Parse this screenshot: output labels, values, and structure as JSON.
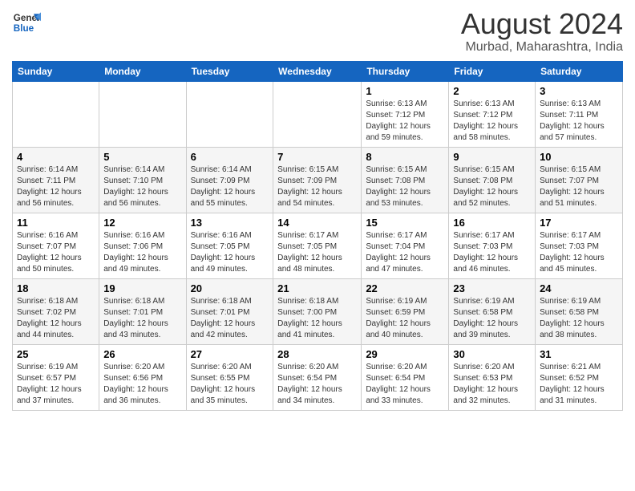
{
  "header": {
    "logo_line1": "General",
    "logo_line2": "Blue",
    "main_title": "August 2024",
    "subtitle": "Murbad, Maharashtra, India"
  },
  "days_of_week": [
    "Sunday",
    "Monday",
    "Tuesday",
    "Wednesday",
    "Thursday",
    "Friday",
    "Saturday"
  ],
  "weeks": [
    [
      {
        "day": "",
        "info": ""
      },
      {
        "day": "",
        "info": ""
      },
      {
        "day": "",
        "info": ""
      },
      {
        "day": "",
        "info": ""
      },
      {
        "day": "1",
        "info": "Sunrise: 6:13 AM\nSunset: 7:12 PM\nDaylight: 12 hours\nand 59 minutes."
      },
      {
        "day": "2",
        "info": "Sunrise: 6:13 AM\nSunset: 7:12 PM\nDaylight: 12 hours\nand 58 minutes."
      },
      {
        "day": "3",
        "info": "Sunrise: 6:13 AM\nSunset: 7:11 PM\nDaylight: 12 hours\nand 57 minutes."
      }
    ],
    [
      {
        "day": "4",
        "info": "Sunrise: 6:14 AM\nSunset: 7:11 PM\nDaylight: 12 hours\nand 56 minutes."
      },
      {
        "day": "5",
        "info": "Sunrise: 6:14 AM\nSunset: 7:10 PM\nDaylight: 12 hours\nand 56 minutes."
      },
      {
        "day": "6",
        "info": "Sunrise: 6:14 AM\nSunset: 7:09 PM\nDaylight: 12 hours\nand 55 minutes."
      },
      {
        "day": "7",
        "info": "Sunrise: 6:15 AM\nSunset: 7:09 PM\nDaylight: 12 hours\nand 54 minutes."
      },
      {
        "day": "8",
        "info": "Sunrise: 6:15 AM\nSunset: 7:08 PM\nDaylight: 12 hours\nand 53 minutes."
      },
      {
        "day": "9",
        "info": "Sunrise: 6:15 AM\nSunset: 7:08 PM\nDaylight: 12 hours\nand 52 minutes."
      },
      {
        "day": "10",
        "info": "Sunrise: 6:15 AM\nSunset: 7:07 PM\nDaylight: 12 hours\nand 51 minutes."
      }
    ],
    [
      {
        "day": "11",
        "info": "Sunrise: 6:16 AM\nSunset: 7:07 PM\nDaylight: 12 hours\nand 50 minutes."
      },
      {
        "day": "12",
        "info": "Sunrise: 6:16 AM\nSunset: 7:06 PM\nDaylight: 12 hours\nand 49 minutes."
      },
      {
        "day": "13",
        "info": "Sunrise: 6:16 AM\nSunset: 7:05 PM\nDaylight: 12 hours\nand 49 minutes."
      },
      {
        "day": "14",
        "info": "Sunrise: 6:17 AM\nSunset: 7:05 PM\nDaylight: 12 hours\nand 48 minutes."
      },
      {
        "day": "15",
        "info": "Sunrise: 6:17 AM\nSunset: 7:04 PM\nDaylight: 12 hours\nand 47 minutes."
      },
      {
        "day": "16",
        "info": "Sunrise: 6:17 AM\nSunset: 7:03 PM\nDaylight: 12 hours\nand 46 minutes."
      },
      {
        "day": "17",
        "info": "Sunrise: 6:17 AM\nSunset: 7:03 PM\nDaylight: 12 hours\nand 45 minutes."
      }
    ],
    [
      {
        "day": "18",
        "info": "Sunrise: 6:18 AM\nSunset: 7:02 PM\nDaylight: 12 hours\nand 44 minutes."
      },
      {
        "day": "19",
        "info": "Sunrise: 6:18 AM\nSunset: 7:01 PM\nDaylight: 12 hours\nand 43 minutes."
      },
      {
        "day": "20",
        "info": "Sunrise: 6:18 AM\nSunset: 7:01 PM\nDaylight: 12 hours\nand 42 minutes."
      },
      {
        "day": "21",
        "info": "Sunrise: 6:18 AM\nSunset: 7:00 PM\nDaylight: 12 hours\nand 41 minutes."
      },
      {
        "day": "22",
        "info": "Sunrise: 6:19 AM\nSunset: 6:59 PM\nDaylight: 12 hours\nand 40 minutes."
      },
      {
        "day": "23",
        "info": "Sunrise: 6:19 AM\nSunset: 6:58 PM\nDaylight: 12 hours\nand 39 minutes."
      },
      {
        "day": "24",
        "info": "Sunrise: 6:19 AM\nSunset: 6:58 PM\nDaylight: 12 hours\nand 38 minutes."
      }
    ],
    [
      {
        "day": "25",
        "info": "Sunrise: 6:19 AM\nSunset: 6:57 PM\nDaylight: 12 hours\nand 37 minutes."
      },
      {
        "day": "26",
        "info": "Sunrise: 6:20 AM\nSunset: 6:56 PM\nDaylight: 12 hours\nand 36 minutes."
      },
      {
        "day": "27",
        "info": "Sunrise: 6:20 AM\nSunset: 6:55 PM\nDaylight: 12 hours\nand 35 minutes."
      },
      {
        "day": "28",
        "info": "Sunrise: 6:20 AM\nSunset: 6:54 PM\nDaylight: 12 hours\nand 34 minutes."
      },
      {
        "day": "29",
        "info": "Sunrise: 6:20 AM\nSunset: 6:54 PM\nDaylight: 12 hours\nand 33 minutes."
      },
      {
        "day": "30",
        "info": "Sunrise: 6:20 AM\nSunset: 6:53 PM\nDaylight: 12 hours\nand 32 minutes."
      },
      {
        "day": "31",
        "info": "Sunrise: 6:21 AM\nSunset: 6:52 PM\nDaylight: 12 hours\nand 31 minutes."
      }
    ]
  ]
}
